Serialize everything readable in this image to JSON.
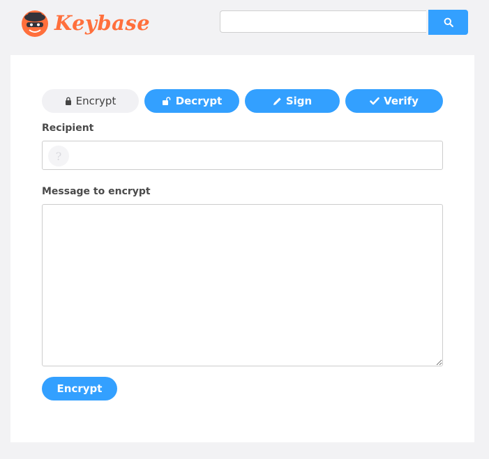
{
  "header": {
    "logo_text": "Keybase",
    "search": {
      "value": "",
      "placeholder": ""
    },
    "search_icon": "search-icon"
  },
  "tabs": [
    {
      "label": "Encrypt",
      "icon": "lock-icon",
      "active": true
    },
    {
      "label": "Decrypt",
      "icon": "unlock-icon",
      "active": false
    },
    {
      "label": "Sign",
      "icon": "pencil-icon",
      "active": false
    },
    {
      "label": "Verify",
      "icon": "check-icon",
      "active": false
    }
  ],
  "form": {
    "recipient_label": "Recipient",
    "recipient_value": "",
    "recipient_avatar_glyph": "?",
    "message_label": "Message to encrypt",
    "message_value": "",
    "submit_label": "Encrypt"
  },
  "colors": {
    "accent": "#33a0ff",
    "brand": "#ff6f3c",
    "page_bg": "#f2f2f4",
    "card_bg": "#ffffff"
  }
}
